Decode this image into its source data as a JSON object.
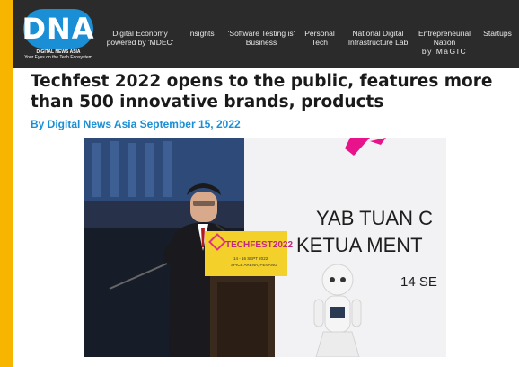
{
  "logo": {
    "text": "DNA",
    "sub1": "DIGITAL NEWS ASIA",
    "sub2": "Your Eyes on the Tech Ecosystem"
  },
  "nav": [
    {
      "line1": "Digital Economy",
      "line2": "powered by 'MDEC'"
    },
    {
      "line1": "Insights"
    },
    {
      "line1": "'Software Testing is'",
      "line2": "Business"
    },
    {
      "line1": "Personal",
      "line2": "Tech"
    },
    {
      "line1": "National Digital",
      "line2": "Infrastructure Lab"
    },
    {
      "line1": "Entrepreneurial",
      "line2": "Nation",
      "line3": "by MaGIC"
    },
    {
      "line1": "Startups"
    }
  ],
  "article": {
    "title": "Techfest 2022 opens to the public, features more than 500 innovative brands, products",
    "byline": "By Digital News Asia September 15, 2022"
  },
  "photo": {
    "screen_line1": "YAB TUAN C",
    "screen_line2": "KETUA MENT",
    "screen_line3": "14 SE",
    "sign_title": "TECHFEST2022",
    "sign_line1": "14 - 16 SEPT 2022",
    "sign_line2": "SPICE ARENA, PENANG"
  }
}
